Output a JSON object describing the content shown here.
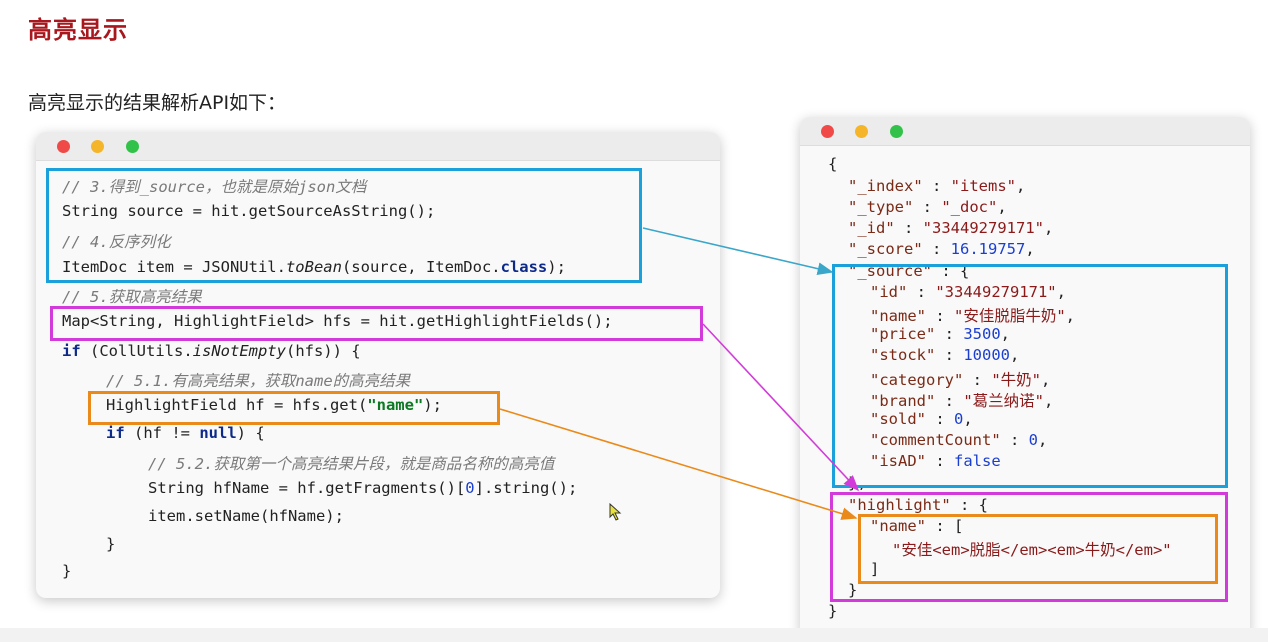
{
  "header": {
    "title": "高亮显示",
    "subtitle": "高亮显示的结果解析API如下："
  },
  "left_code": {
    "c1": "// 3.得到_source，也就是原始json文档",
    "l1": "String source = hit.getSourceAsString();",
    "c2": "// 4.反序列化",
    "l2a": "ItemDoc item = JSONUtil.",
    "l2b": "toBean",
    "l2c": "(source, ItemDoc.",
    "l2d": "class",
    "l2e": ");",
    "c3": "// 5.获取高亮结果",
    "l3": "Map<String, HighlightField> hfs = hit.getHighlightFields();",
    "l4a": "if",
    "l4b": " (CollUtils.",
    "l4c": "isNotEmpty",
    "l4d": "(hfs)) {",
    "c4": "// 5.1.有高亮结果，获取name的高亮结果",
    "l5a": "HighlightField hf = hfs.get(",
    "l5b": "\"name\"",
    "l5c": ");",
    "l6a": "if",
    "l6b": " (hf != ",
    "l6c": "null",
    "l6d": ") {",
    "c5": "// 5.2.获取第一个高亮结果片段，就是商品名称的高亮值",
    "l7a": "String hfName = hf.getFragments()[",
    "l7b": "0",
    "l7c": "].string();",
    "l8": "item.setName(hfName);",
    "l9": "}",
    "l10": "}"
  },
  "right_json": {
    "open": "{",
    "index_k": "\"_index\"",
    "index_v": "\"items\"",
    "type_k": "\"_type\"",
    "type_v": "\"_doc\"",
    "id_k": "\"_id\"",
    "id_v": "\"33449279171\"",
    "score_k": "\"_score\"",
    "score_v": "16.19757",
    "source_k": "\"_source\"",
    "s_id_k": "\"id\"",
    "s_id_v": "\"33449279171\"",
    "s_name_k": "\"name\"",
    "s_name_v": "\"安佳脱脂牛奶\"",
    "s_price_k": "\"price\"",
    "s_price_v": "3500",
    "s_stock_k": "\"stock\"",
    "s_stock_v": "10000",
    "s_cat_k": "\"category\"",
    "s_cat_v": "\"牛奶\"",
    "s_brand_k": "\"brand\"",
    "s_brand_v": "\"葛兰纳诺\"",
    "s_sold_k": "\"sold\"",
    "s_sold_v": "0",
    "s_cc_k": "\"commentCount\"",
    "s_cc_v": "0",
    "s_ad_k": "\"isAD\"",
    "s_ad_v": "false",
    "source_close": "},",
    "hl_k": "\"highlight\"",
    "hl_name_k": "\"name\"",
    "hl_val": "\"安佳<em>脱脂</em><em>牛奶</em>\"",
    "hl_arr_close": "]",
    "hl_close": "}",
    "close": "}"
  },
  "colors": {
    "title": "#a8171d",
    "box_blue": "#1aa1db",
    "box_pink": "#d23bd9",
    "box_orange": "#ea8a1a"
  }
}
